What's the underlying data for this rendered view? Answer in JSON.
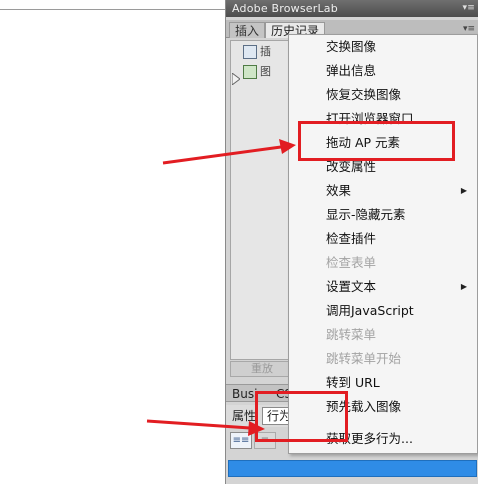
{
  "panel": {
    "title": "Adobe BrowserLab",
    "title_menu_icon": "panel-menu-icon"
  },
  "tabs": [
    {
      "label": "插入"
    },
    {
      "label": "历史记录"
    }
  ],
  "history": {
    "items": [
      {
        "label": "插",
        "icon": "insert-div-icon"
      },
      {
        "label": "图",
        "icon": "image-icon"
      }
    ],
    "replay_label": "重放"
  },
  "bottom": {
    "sub_tabs": [
      "Busi",
      "CS"
    ],
    "props_label": "属性",
    "behavior_tab_label": "行为",
    "tool_icons": [
      "show-set-events-icon",
      "show-all-events-icon"
    ],
    "accent_color": "#2f8ce6"
  },
  "context_menu": {
    "items": [
      {
        "label": "交换图像",
        "enabled": true,
        "submenu": false
      },
      {
        "label": "弹出信息",
        "enabled": true,
        "submenu": false
      },
      {
        "label": "恢复交换图像",
        "enabled": true,
        "submenu": false
      },
      {
        "label": "打开浏览器窗口",
        "enabled": true,
        "submenu": false
      },
      {
        "label": "拖动 AP 元素",
        "enabled": true,
        "submenu": false
      },
      {
        "label": "改变属性",
        "enabled": true,
        "submenu": false
      },
      {
        "label": "效果",
        "enabled": true,
        "submenu": true
      },
      {
        "label": "显示-隐藏元素",
        "enabled": true,
        "submenu": false
      },
      {
        "label": "检查插件",
        "enabled": true,
        "submenu": false
      },
      {
        "label": "检查表单",
        "enabled": false,
        "submenu": false
      },
      {
        "label": "设置文本",
        "enabled": true,
        "submenu": true
      },
      {
        "label": "调用JavaScript",
        "enabled": true,
        "submenu": false
      },
      {
        "label": "跳转菜单",
        "enabled": false,
        "submenu": false
      },
      {
        "label": "跳转菜单开始",
        "enabled": false,
        "submenu": false
      },
      {
        "label": "转到 URL",
        "enabled": true,
        "submenu": false
      },
      {
        "label": "预先载入图像",
        "enabled": true,
        "submenu": false
      },
      {
        "label": "获取更多行为...",
        "enabled": true,
        "submenu": false
      }
    ]
  },
  "annotations": {
    "highlight_color": "#e21d22",
    "highlighted_menu_item": "拖动 AP 元素"
  }
}
